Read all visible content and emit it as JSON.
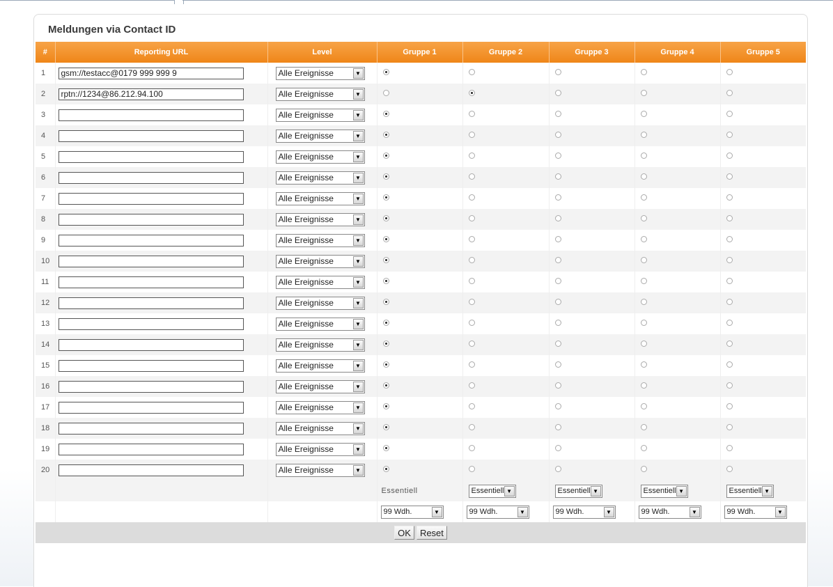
{
  "panel": {
    "title": "Meldungen via Contact ID"
  },
  "table": {
    "headers": [
      "#",
      "Reporting URL",
      "Level",
      "Gruppe 1",
      "Gruppe 2",
      "Gruppe 3",
      "Gruppe 4",
      "Gruppe 5"
    ],
    "level_default": "Alle Ereignisse",
    "rows": [
      {
        "num": "1",
        "url": "gsm://testacc@0179 999 999 9",
        "selected_group": 1
      },
      {
        "num": "2",
        "url": "rptn://1234@86.212.94.100",
        "selected_group": 2
      },
      {
        "num": "3",
        "url": "",
        "selected_group": 1
      },
      {
        "num": "4",
        "url": "",
        "selected_group": 1
      },
      {
        "num": "5",
        "url": "",
        "selected_group": 1
      },
      {
        "num": "6",
        "url": "",
        "selected_group": 1
      },
      {
        "num": "7",
        "url": "",
        "selected_group": 1
      },
      {
        "num": "8",
        "url": "",
        "selected_group": 1
      },
      {
        "num": "9",
        "url": "",
        "selected_group": 1
      },
      {
        "num": "10",
        "url": "",
        "selected_group": 1
      },
      {
        "num": "11",
        "url": "",
        "selected_group": 1
      },
      {
        "num": "12",
        "url": "",
        "selected_group": 1
      },
      {
        "num": "13",
        "url": "",
        "selected_group": 1
      },
      {
        "num": "14",
        "url": "",
        "selected_group": 1
      },
      {
        "num": "15",
        "url": "",
        "selected_group": 1
      },
      {
        "num": "16",
        "url": "",
        "selected_group": 1
      },
      {
        "num": "17",
        "url": "",
        "selected_group": 1
      },
      {
        "num": "18",
        "url": "",
        "selected_group": 1
      },
      {
        "num": "19",
        "url": "",
        "selected_group": 1
      },
      {
        "num": "20",
        "url": "",
        "selected_group": 1
      }
    ],
    "essential": {
      "group1_text": "Essentiell",
      "group_selects": [
        "Essentiell",
        "Essentiell",
        "Essentiell",
        "Essentiell"
      ]
    },
    "repeat": {
      "group_selects": [
        "99 Wdh.",
        "99 Wdh.",
        "99 Wdh.",
        "99 Wdh.",
        "99 Wdh."
      ]
    }
  },
  "buttons": {
    "ok": "OK",
    "reset": "Reset"
  },
  "icons": {
    "dropdown": "chevron-down-icon"
  },
  "colors": {
    "header_orange": "#ef8618",
    "row_alt": "#f3f3f3",
    "footer": "#dcdcdc"
  }
}
